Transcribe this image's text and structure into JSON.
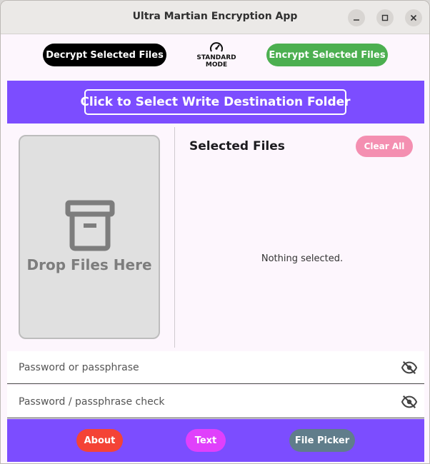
{
  "window": {
    "title": "Ultra Martian Encryption App"
  },
  "toolbar": {
    "decrypt_label": "Decrypt Selected Files",
    "encrypt_label": "Encrypt Selected Files",
    "mode_label": "STANDARD MODE",
    "mode_icon": "speedometer-icon"
  },
  "destination": {
    "label": "Click to Select Write Destination Folder"
  },
  "dropzone": {
    "label": "Drop Files Here",
    "icon": "archive-box-icon"
  },
  "files_panel": {
    "title": "Selected Files",
    "clear_label": "Clear All",
    "empty_text": "Nothing selected."
  },
  "password": {
    "placeholder": "Password or passphrase",
    "check_placeholder": "Password / passphrase check",
    "visibility_icon": "eye-off-icon"
  },
  "bottom": {
    "about_label": "About",
    "text_label": "Text",
    "picker_label": "File Picker"
  },
  "colors": {
    "accent": "#7c4dff",
    "encrypt": "#4caf50",
    "decrypt": "#000000",
    "clear": "#f48fb1",
    "about": "#f44336",
    "text": "#e040fb",
    "picker": "#607d8b"
  }
}
